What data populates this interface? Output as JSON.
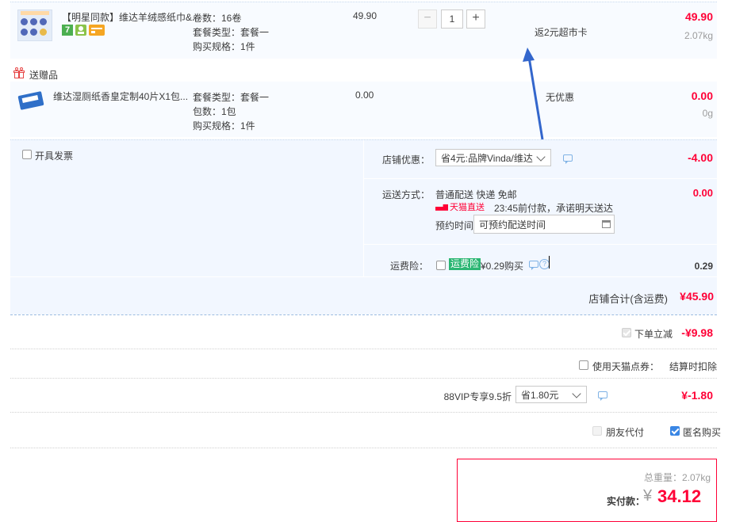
{
  "product1": {
    "title": "【明星同款】维达羊绒感纸巾&...",
    "spec_rolls": "卷数：16卷",
    "spec_package": "套餐类型：套餐一",
    "spec_qty": "购买规格：1件",
    "unit_price": "49.90",
    "quantity": "1",
    "promo": "返2元超市卡",
    "total": "49.90",
    "weight": "2.07kg",
    "badge_seven": "7"
  },
  "gift": {
    "section_label": "送赠品",
    "title": "维达湿厕纸香皇定制40片X1包...",
    "spec_package": "套餐类型：套餐一",
    "spec_count": "包数：1包",
    "spec_qty": "购买规格：1件",
    "unit_price": "0.00",
    "promo": "无优惠",
    "total": "0.00",
    "weight": "0g"
  },
  "invoice": {
    "label": "开具发票"
  },
  "shop_discount": {
    "label": "店铺优惠：",
    "selected": "省4元:品牌Vinda/维达",
    "amount": "-4.00"
  },
  "shipping": {
    "label": "运送方式：",
    "method": "普通配送 快递 免邮",
    "badge": "天猫直送",
    "promise": "23:45前付款，承诺明天送达",
    "schedule_label": "预约时间",
    "schedule_value": "可预约配送时间",
    "amount": "0.00"
  },
  "insurance": {
    "label": "运费险：",
    "badge": "运费险",
    "price_text": "¥0.29购买",
    "amount": "0.29"
  },
  "shop_total": {
    "label": "店铺合计(含运费)",
    "amount": "¥45.90"
  },
  "instant_discount": {
    "label": "下单立减",
    "amount": "-¥9.98"
  },
  "tmall_points": {
    "label": "使用天猫点券：",
    "note": "结算时扣除"
  },
  "vip": {
    "label": "88VIP专享9.5折",
    "selected": "省1.80元",
    "amount": "¥-1.80"
  },
  "options": {
    "friend_pay": "朋友代付",
    "anonymous": "匿名购买"
  },
  "summary": {
    "weight_label": "总重量：",
    "weight": "2.07kg",
    "pay_label": "实付款：",
    "currency": "¥",
    "amount": "34.12"
  },
  "colors": {
    "accent_red": "#ff0036",
    "panel_blue": "#f2f7ff",
    "arrow_blue": "#3366cc"
  }
}
